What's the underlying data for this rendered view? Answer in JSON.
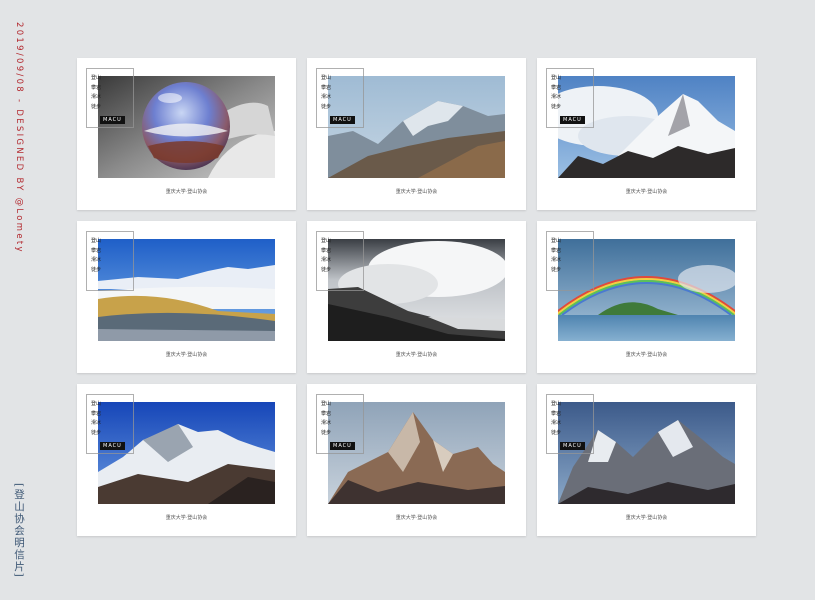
{
  "side_credit": "2019/09/08 - DESIGNED BY @Lomety",
  "side_title": "[登山协会明信片]",
  "card_common": {
    "lines": [
      "登山",
      "攀岩",
      "滑冰",
      "徒步"
    ],
    "badge": "MACU",
    "caption": "重庆大学·登山协会"
  },
  "cards": [
    {
      "image": "crystal-ball-photo"
    },
    {
      "image": "hazy-mountain-photo"
    },
    {
      "image": "cloudy-snow-peak-photo"
    },
    {
      "image": "alpine-panorama-photo"
    },
    {
      "image": "misty-slope-photo"
    },
    {
      "image": "rainbow-lake-photo"
    },
    {
      "image": "blue-sky-peak-photo"
    },
    {
      "image": "rocky-spire-photo"
    },
    {
      "image": "twin-peaks-photo"
    }
  ]
}
